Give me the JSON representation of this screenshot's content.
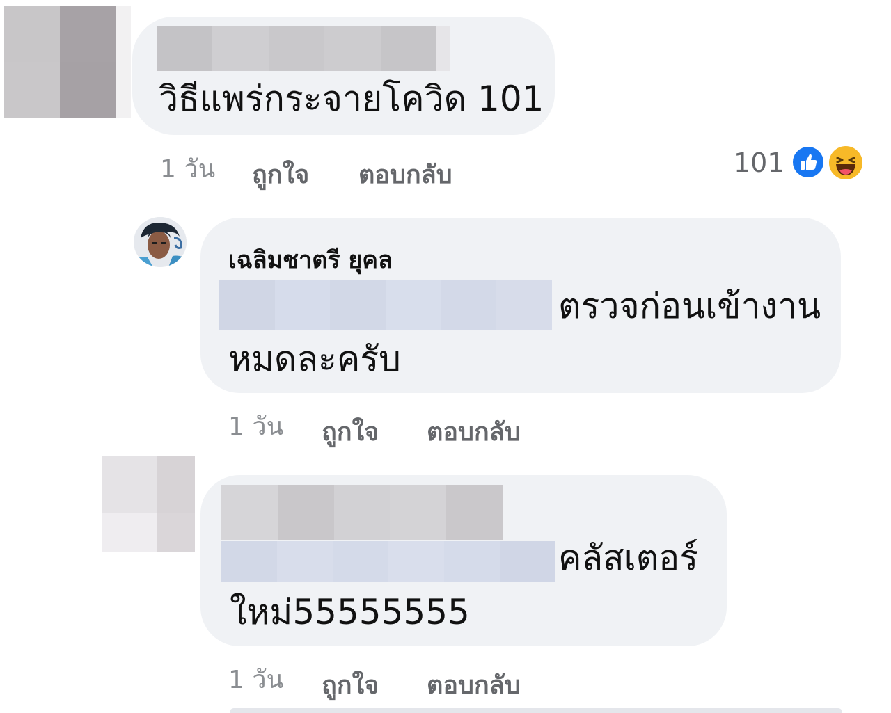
{
  "comments": [
    {
      "author": "",
      "text_lines": [
        "วิธีแพร่กระจายโควิด 101"
      ],
      "actions": {
        "time": "1 วัน",
        "like": "ถูกใจ",
        "reply": "ตอบกลับ"
      },
      "reactions": {
        "count": "101",
        "icons": [
          "like-icon",
          "haha-icon"
        ]
      }
    },
    {
      "author": "เฉลิมชาตรี ยุคล",
      "text_lines": [
        "ตรวจก่อนเข้างาน",
        "หมดละครับ"
      ],
      "actions": {
        "time": "1 วัน",
        "like": "ถูกใจ",
        "reply": "ตอบกลับ"
      }
    },
    {
      "author": "",
      "text_lines": [
        "คลัสเตอร์",
        "ใหม่55555555"
      ],
      "actions": {
        "time": "1 วัน",
        "like": "ถูกใจ",
        "reply": "ตอบกลับ"
      }
    }
  ],
  "colors": {
    "bubble": "#f0f2f5",
    "action_text": "#65676b",
    "like_blue": "#1877f2",
    "haha_yellow": "#f7b928"
  }
}
